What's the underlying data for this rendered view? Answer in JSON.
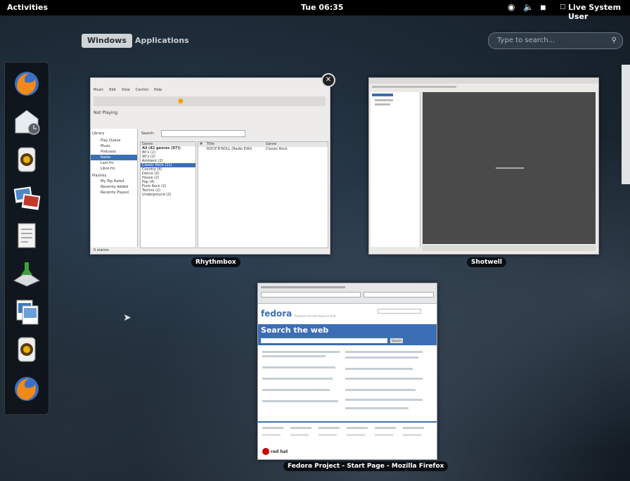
{
  "topbar": {
    "activities": "Activities",
    "clock": "Tue 06:35",
    "user": "Live System User",
    "status_icons": [
      "accessibility-icon",
      "volume-icon",
      "battery-icon",
      "user-icon"
    ]
  },
  "overview": {
    "tabs": [
      {
        "label": "Windows",
        "active": true
      },
      {
        "label": "Applications",
        "active": false
      }
    ],
    "search_placeholder": "Type to search..."
  },
  "dash": {
    "items": [
      "firefox",
      "evolution-mail",
      "rhythmbox",
      "shotwell",
      "document-viewer",
      "install-to-hard-drive",
      "image-viewer",
      "rhythmbox-running",
      "firefox-running"
    ]
  },
  "windows": [
    {
      "title": "Rhythmbox",
      "menu": [
        "Music",
        "Edit",
        "View",
        "Control",
        "Help"
      ],
      "now_playing": "Not Playing",
      "sidebar_header": "Library",
      "sidebar": [
        "Play Queue",
        "Music",
        "Podcasts",
        "Radio",
        "Last.fm",
        "Libre.fm"
      ],
      "playlists_header": "Playlists",
      "playlists": [
        "My Top Rated",
        "Recently Added",
        "Recently Played"
      ],
      "search_label": "Search:",
      "genres_header": "Genre",
      "genres": [
        "All (42 genres (97))",
        "80's (2)",
        "90's (2)",
        "Ambient (2)",
        "Classic Rock (11)",
        "Country (4)",
        "Dance (2)",
        "House (2)",
        "Pop (4)",
        "Punk Rock (2)",
        "Techno (2)",
        "Underground (2)"
      ],
      "columns": [
        "#",
        "Title",
        "Genre"
      ],
      "row": [
        "",
        "ROCK'N'ROLL (Radio Edit)",
        "Classic Rock"
      ],
      "status": "0 station"
    },
    {
      "title": "Shotwell"
    },
    {
      "title": "Fedora Project - Start Page - Mozilla Firefox",
      "brand": "fedora",
      "tagline": "freedom friends features first",
      "banner": "Search the web",
      "search_button": "Search",
      "footer_brand": "red hat"
    }
  ],
  "colors": {
    "accent": "#3c6eb4",
    "panel": "#000000",
    "active_tab": "#cfd3d6"
  }
}
